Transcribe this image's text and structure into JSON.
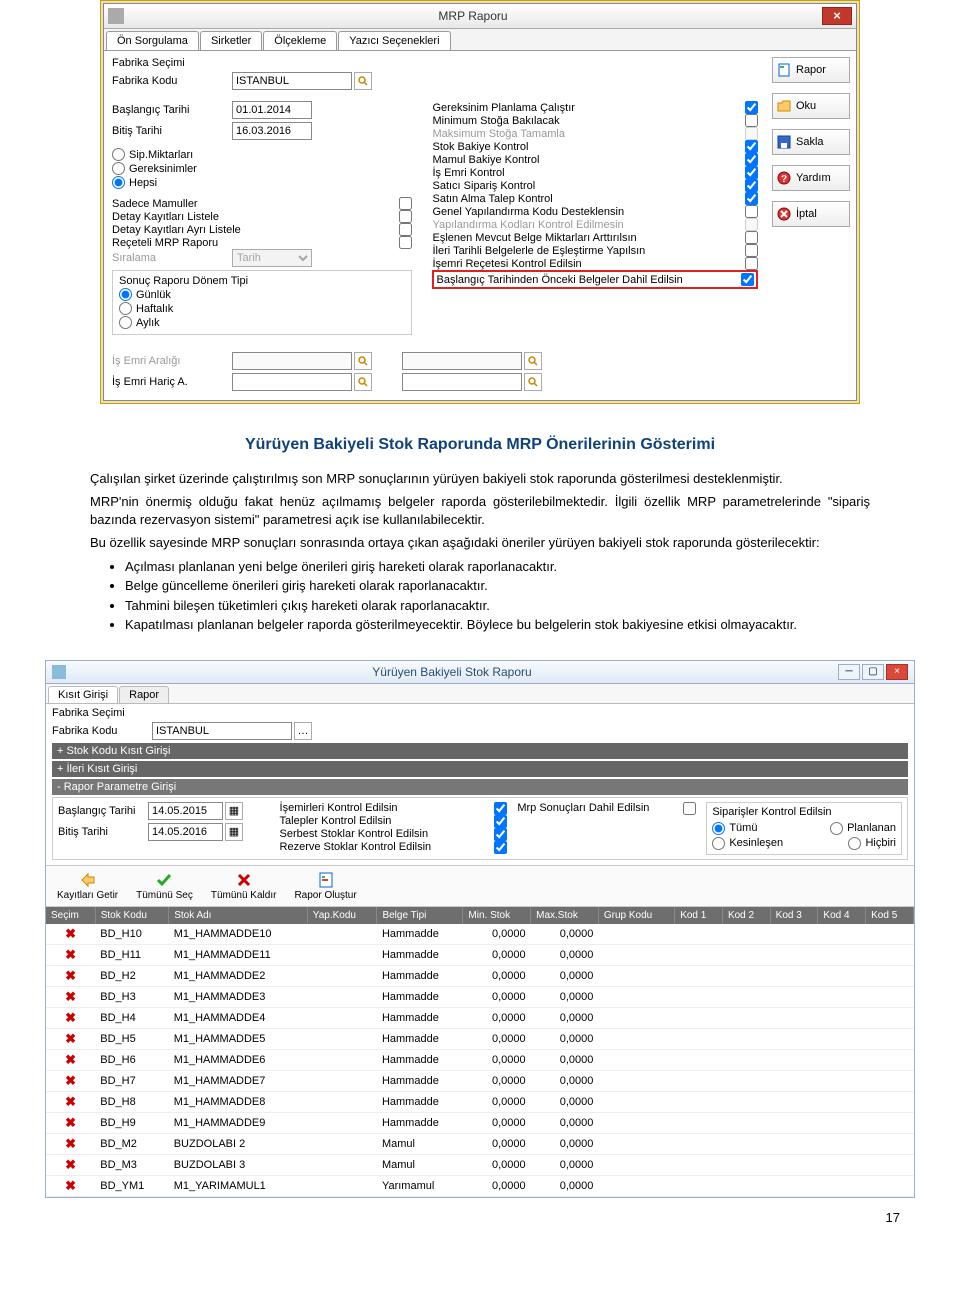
{
  "win1": {
    "title": "MRP Raporu",
    "tabs": [
      "Ön Sorgulama",
      "Sirketler",
      "Ölçekleme",
      "Yazıcı Seçenekleri"
    ],
    "fabrika_secimi_lbl": "Fabrika Seçimi",
    "fabrika_kodu_lbl": "Fabrika Kodu",
    "fabrika_kodu_val": "ISTANBUL",
    "baslangic_lbl": "Başlangıç Tarihi",
    "baslangic_val": "01.01.2014",
    "bitis_lbl": "Bitiş Tarihi",
    "bitis_val": "16.03.2016",
    "radios1": [
      "Sip.Miktarları",
      "Gereksinimler",
      "Hepsi"
    ],
    "radios1_sel": 2,
    "leftchecks": [
      {
        "l": "Sadece Mamuller",
        "v": false
      },
      {
        "l": "Detay Kayıtları Listele",
        "v": false
      },
      {
        "l": "Detay Kayıtları Ayrı Listele",
        "v": false
      },
      {
        "l": "Reçeteli MRP Raporu",
        "v": false
      }
    ],
    "siralama_lbl": "Sıralama",
    "siralama_val": "Tarih",
    "sonuc_grp_title": "Sonuç Raporu Dönem Tipi",
    "sonuc_radios": [
      "Günlük",
      "Haftalık",
      "Aylık"
    ],
    "sonuc_sel": 0,
    "rightchecks": [
      {
        "l": "Gereksinim Planlama Çalıştır",
        "v": true,
        "d": false
      },
      {
        "l": "Minimum Stoğa Bakılacak",
        "v": false,
        "d": false
      },
      {
        "l": "Maksimum Stoğa Tamamla",
        "v": false,
        "d": true
      },
      {
        "l": "Stok Bakiye Kontrol",
        "v": true,
        "d": false
      },
      {
        "l": "Mamul Bakiye Kontrol",
        "v": true,
        "d": false
      },
      {
        "l": "İş Emri Kontrol",
        "v": true,
        "d": false
      },
      {
        "l": "Satıcı Sipariş Kontrol",
        "v": true,
        "d": false
      },
      {
        "l": "Satın Alma Talep Kontrol",
        "v": true,
        "d": false
      },
      {
        "l": "Genel Yapılandırma Kodu Desteklensin",
        "v": false,
        "d": false
      },
      {
        "l": "Yapılandırma Kodları Kontrol Edilmesin",
        "v": false,
        "d": true
      },
      {
        "l": "Eşlenen Mevcut Belge Miktarları Arttırılsın",
        "v": false,
        "d": false
      },
      {
        "l": "İleri Tarihli Belgelerle de Eşleştirme Yapılsın",
        "v": false,
        "d": false
      },
      {
        "l": "İşemri Reçetesi Kontrol Edilsin",
        "v": false,
        "d": false
      }
    ],
    "highlight_lbl": "Başlangıç Tarihinden Önceki Belgeler Dahil Edilsin",
    "highlight_v": true,
    "isemri_araligi_lbl": "İş Emri Aralığı",
    "isemri_haric_lbl": "İş Emri Hariç A.",
    "buttons": {
      "rapor": "Rapor",
      "oku": "Oku",
      "sakla": "Sakla",
      "yardim": "Yardım",
      "iptal": "İptal"
    }
  },
  "article": {
    "heading": "Yürüyen Bakiyeli Stok Raporunda MRP Önerilerinin Gösterimi",
    "p1": "Çalışılan şirket üzerinde çalıştırılmış son MRP sonuçlarının yürüyen bakiyeli stok raporunda gösterilmesi desteklenmiştir.",
    "p2": "MRP'nin önermiş olduğu fakat henüz açılmamış belgeler raporda gösterilebilmektedir. İlgili özellik MRP parametrelerinde \"sipariş bazında rezervasyon sistemi\" parametresi açık ise kullanılabilecektir.",
    "p3a": "Bu özellik sayesinde MRP sonuçları sonrasında ortaya çıkan aşağıdaki öneriler yürüyen bakiyeli stok raporunda gösterilecektir:",
    "bul": [
      "Açılması planlanan yeni belge önerileri giriş hareketi olarak raporlanacaktır.",
      "Belge güncelleme önerileri giriş hareketi olarak raporlanacaktır.",
      "Tahmini bileşen tüketimleri çıkış hareketi olarak raporlanacaktır.",
      "Kapatılması planlanan belgeler raporda gösterilmeyecektir. Böylece bu belgelerin stok bakiyesine etkisi olmayacaktır."
    ]
  },
  "win2": {
    "title": "Yürüyen Bakiyeli Stok Raporu",
    "tabs": [
      "Kısıt Girişi",
      "Rapor"
    ],
    "fabrika_secimi_lbl": "Fabrika Seçimi",
    "fabrika_kodu_lbl": "Fabrika Kodu",
    "fabrika_kodu_val": "ISTANBUL",
    "exp1": "+ Stok Kodu Kısıt Girişi",
    "exp2": "+ İleri Kısıt Girişi",
    "exp3": "- Rapor Parametre Girişi",
    "bas_lbl": "Başlangıç Tarihi",
    "bas_val": "14.05.2015",
    "bit_lbl": "Bitiş Tarihi",
    "bit_val": "14.05.2016",
    "c2": [
      {
        "l": "İşemirleri Kontrol Edilsin",
        "v": true
      },
      {
        "l": "Talepler Kontrol Edilsin",
        "v": true
      },
      {
        "l": "Serbest Stoklar Kontrol Edilsin",
        "v": true
      },
      {
        "l": "Rezerve Stoklar Kontrol Edilsin",
        "v": true
      }
    ],
    "c3": {
      "l": "Mrp Sonuçları Dahil Edilsin",
      "v": false
    },
    "c4_title": "Siparişler Kontrol Edilsin",
    "c4_opts": [
      [
        "Tümü",
        "Planlanan"
      ],
      [
        "Kesinleşen",
        "Hiçbiri"
      ]
    ],
    "c4_sel": "Tümü",
    "toolbar": [
      "Kayıtları Getir",
      "Tümünü Seç",
      "Tümünü Kaldır",
      "Rapor Oluştur"
    ],
    "cols": [
      "Seçim",
      "Stok Kodu",
      "Stok Adı",
      "Yap.Kodu",
      "Belge Tipi",
      "Min. Stok",
      "Max.Stok",
      "Grup Kodu",
      "Kod 1",
      "Kod 2",
      "Kod 3",
      "Kod 4",
      "Kod 5"
    ],
    "rows": [
      [
        "BD_H10",
        "M1_HAMMADDE10",
        "Hammadde",
        "0,0000",
        "0,0000"
      ],
      [
        "BD_H11",
        "M1_HAMMADDE11",
        "Hammadde",
        "0,0000",
        "0,0000"
      ],
      [
        "BD_H2",
        "M1_HAMMADDE2",
        "Hammadde",
        "0,0000",
        "0,0000"
      ],
      [
        "BD_H3",
        "M1_HAMMADDE3",
        "Hammadde",
        "0,0000",
        "0,0000"
      ],
      [
        "BD_H4",
        "M1_HAMMADDE4",
        "Hammadde",
        "0,0000",
        "0,0000"
      ],
      [
        "BD_H5",
        "M1_HAMMADDE5",
        "Hammadde",
        "0,0000",
        "0,0000"
      ],
      [
        "BD_H6",
        "M1_HAMMADDE6",
        "Hammadde",
        "0,0000",
        "0,0000"
      ],
      [
        "BD_H7",
        "M1_HAMMADDE7",
        "Hammadde",
        "0,0000",
        "0,0000"
      ],
      [
        "BD_H8",
        "M1_HAMMADDE8",
        "Hammadde",
        "0,0000",
        "0,0000"
      ],
      [
        "BD_H9",
        "M1_HAMMADDE9",
        "Hammadde",
        "0,0000",
        "0,0000"
      ],
      [
        "BD_M2",
        "BUZDOLABI 2",
        "Mamul",
        "0,0000",
        "0,0000"
      ],
      [
        "BD_M3",
        "BUZDOLABI 3",
        "Mamul",
        "0,0000",
        "0,0000"
      ],
      [
        "BD_YM1",
        "M1_YARIMAMUL1",
        "Yarımamul",
        "0,0000",
        "0,0000"
      ]
    ]
  },
  "pagenum": "17"
}
